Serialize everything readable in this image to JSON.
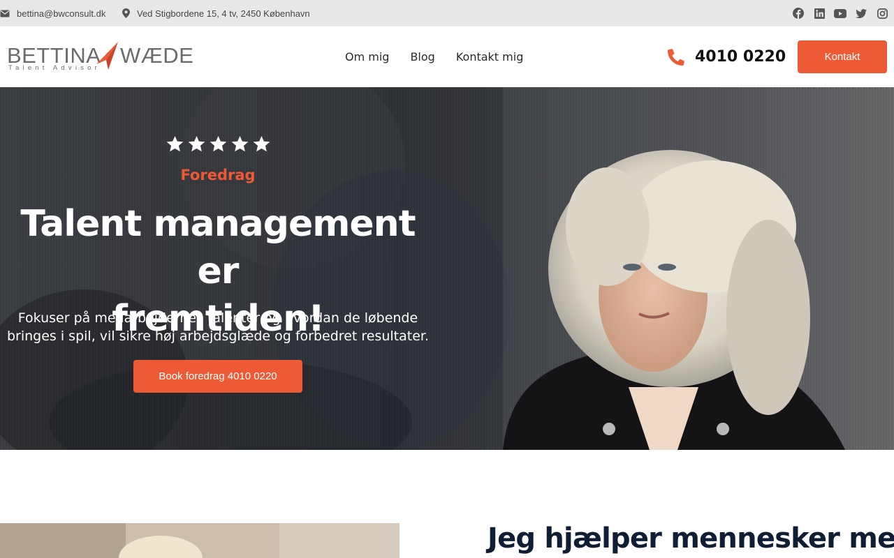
{
  "topbar": {
    "email": "bettina@bwconsult.dk",
    "address": "Ved Stigbordene 15, 4 tv, 2450 København",
    "socials": [
      "facebook-icon",
      "linkedin-icon",
      "youtube-icon",
      "twitter-icon",
      "instagram-icon"
    ]
  },
  "header": {
    "logo": {
      "first": "BETTINA",
      "last": "WÆDE",
      "tagline": "Talent Advisor"
    },
    "nav": [
      "Om mig",
      "Blog",
      "Kontakt mig"
    ],
    "phone": "4010 0220",
    "cta": "Kontakt"
  },
  "hero": {
    "rating": 5,
    "kicker": "Foredrag",
    "title_line1": "Talent management er",
    "title_line2": "fremtiden!",
    "lead_line1": "Fokuser på medarbejdernes talenter og hvordan de løbende",
    "lead_line2": "bringes i spil, vil sikre høj arbejdsglæde og forbedret resultater.",
    "button": "Book foredrag 4010 0220"
  },
  "section": {
    "heading": "Jeg hjælper mennesker med"
  },
  "colors": {
    "accent": "#ee5a35",
    "heading_dark": "#0f1d35",
    "topbar_bg": "#e8e8e8"
  }
}
